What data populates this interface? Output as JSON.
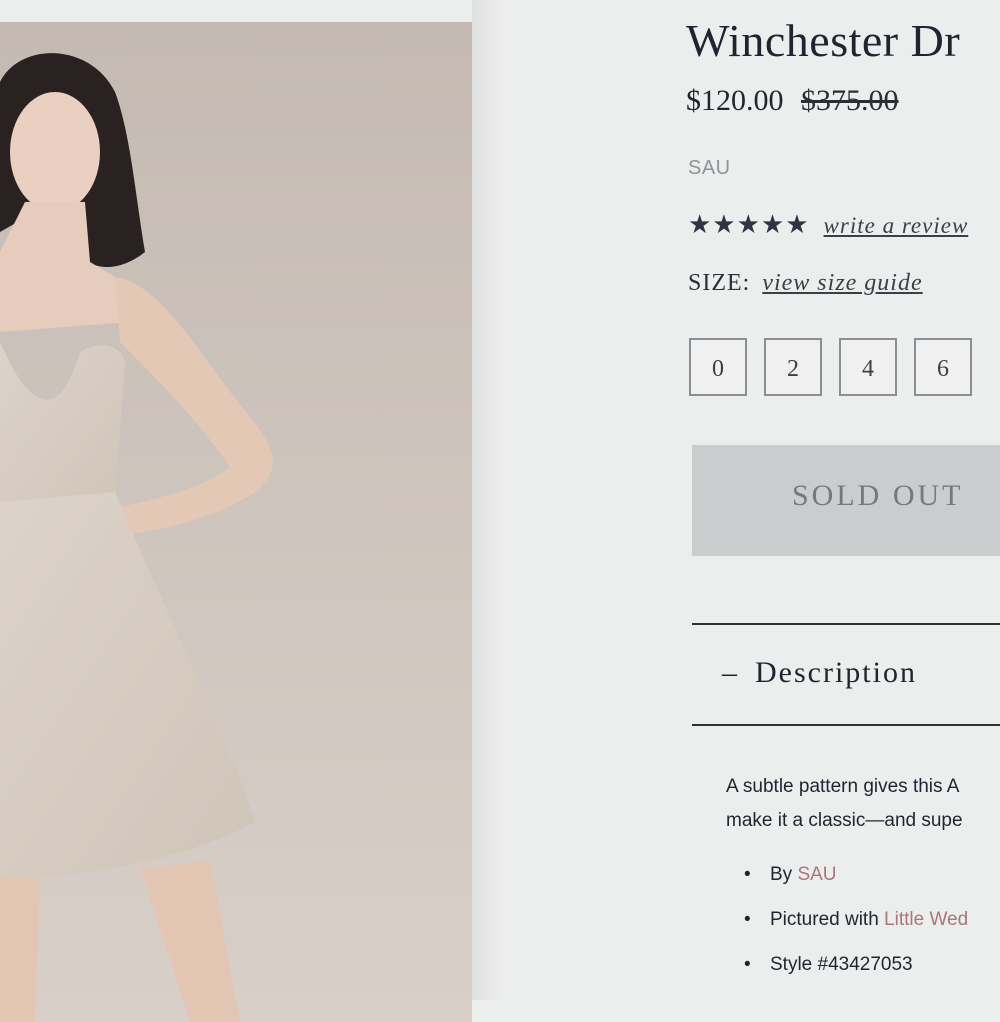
{
  "product": {
    "title": "Winchester Dr",
    "price_current": "$120.00",
    "price_original": "$375.00",
    "brand": "SAU",
    "stars": "★★★★★",
    "review_link": "write a review",
    "size_label": "SIZE:",
    "size_guide_link": "view size guide",
    "sizes": [
      "0",
      "2",
      "4",
      "6"
    ],
    "sold_out_label": "SOLD OUT"
  },
  "description": {
    "heading_dash": "–",
    "heading": "Description",
    "text_line1": "A subtle pattern gives this A",
    "text_line2": "make it a classic—and supe",
    "bullets": [
      {
        "prefix": "By ",
        "link": "SAU"
      },
      {
        "prefix": "Pictured with ",
        "link": "Little Wed"
      },
      {
        "prefix": "Style #43427053",
        "link": ""
      }
    ]
  },
  "colors": {
    "link_accent": "#a9767a",
    "soldout_bg": "#c9cdcd"
  }
}
